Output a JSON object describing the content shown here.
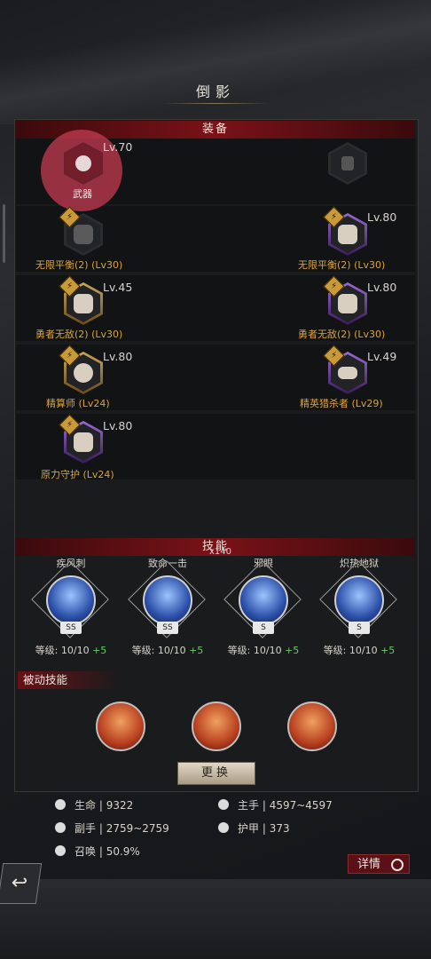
{
  "page_title": "倒影",
  "equipment": {
    "header": "装备",
    "weapon": {
      "level": "Lv.70",
      "label": "武器"
    },
    "slots": [
      {
        "id": "r1l",
        "level": "",
        "caption": "无限平衡(2) (Lv30)",
        "icon": "helmet-icon",
        "rarity": "gray"
      },
      {
        "id": "r1r",
        "level": "Lv.80",
        "caption": "无限平衡(2) (Lv30)",
        "icon": "armor-icon",
        "rarity": "purple"
      },
      {
        "id": "r2l",
        "level": "Lv.45",
        "caption": "勇者无敌(2) (Lv30)",
        "icon": "gauntlet-icon",
        "rarity": "gold"
      },
      {
        "id": "r2r",
        "level": "Lv.80",
        "caption": "勇者无敌(2) (Lv30)",
        "icon": "boots-icon",
        "rarity": "purple"
      },
      {
        "id": "r3l",
        "level": "Lv.80",
        "caption": "精算师 (Lv24)",
        "icon": "ring-icon",
        "rarity": "gold"
      },
      {
        "id": "r3r",
        "level": "Lv.49",
        "caption": "精英猎杀者 (Lv29)",
        "icon": "bracelet-icon",
        "rarity": "purple"
      },
      {
        "id": "r4l",
        "level": "Lv.80",
        "caption": "原力守护 (Lv24)",
        "icon": "cloak-icon",
        "rarity": "purple"
      }
    ]
  },
  "skills": {
    "header": "技能",
    "header_overlay": "x140",
    "active": [
      {
        "name": "疾风刺",
        "grade": "SS",
        "level": "等级: 10/10",
        "bonus": "+5",
        "icon": "spear-icon"
      },
      {
        "name": "致命一击",
        "grade": "SS",
        "level": "等级: 10/10",
        "bonus": "+5",
        "icon": "sword-burst-icon"
      },
      {
        "name": "邪眼",
        "grade": "S",
        "level": "等级: 10/10",
        "bonus": "+5",
        "icon": "eye-icon"
      },
      {
        "name": "炽热地狱",
        "grade": "S",
        "level": "等级: 10/10",
        "bonus": "+5",
        "icon": "flame-icon"
      }
    ],
    "passive_header": "被动技能",
    "passive_icons": [
      "shield-flame-icon",
      "sun-moon-icon",
      "crossed-swords-icon"
    ],
    "change_button": "更换"
  },
  "stats": {
    "hp": {
      "label": "生命",
      "value": "9322"
    },
    "main_hand": {
      "label": "主手",
      "value": "4597~4597"
    },
    "off_hand": {
      "label": "副手",
      "value": "2759~2759"
    },
    "armor": {
      "label": "护甲",
      "value": "373"
    },
    "summon": {
      "label": "召唤",
      "value": "50.9%"
    }
  },
  "detail_button": "详情",
  "colors": {
    "accent_red": "#7a1218",
    "gold": "#d9a43a",
    "plus_green": "#5cd05c"
  }
}
